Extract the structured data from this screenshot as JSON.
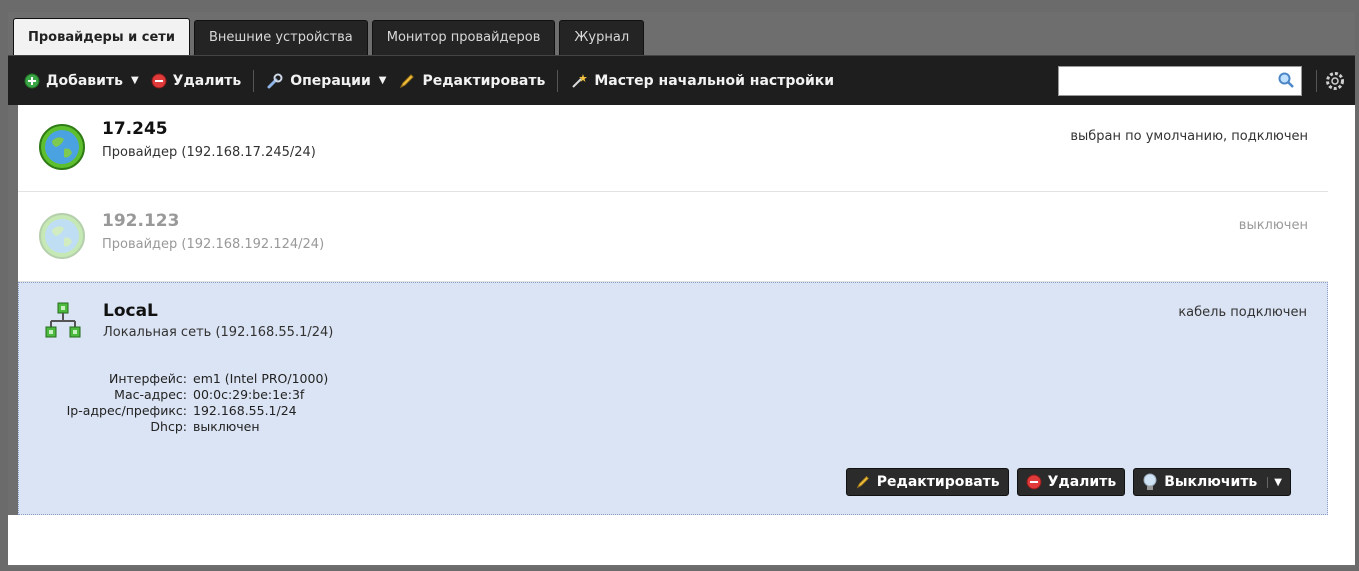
{
  "tabs": [
    {
      "label": "Провайдеры и сети",
      "active": true
    },
    {
      "label": "Внешние устройства",
      "active": false
    },
    {
      "label": "Монитор провайдеров",
      "active": false
    },
    {
      "label": "Журнал",
      "active": false
    }
  ],
  "toolbar": {
    "add_label": "Добавить",
    "delete_label": "Удалить",
    "operations_label": "Операции",
    "edit_label": "Редактировать",
    "wizard_label": "Мастер начальной настройки",
    "search_value": "",
    "search_placeholder": ""
  },
  "items": [
    {
      "name": "17.245",
      "subtitle": "Провайдер (192.168.17.245/24)",
      "state": "выбран по умолчанию, подключен",
      "icon": "globe-icon",
      "enabled": true
    },
    {
      "name": "192.123",
      "subtitle": "Провайдер (192.168.192.124/24)",
      "state": "выключен",
      "icon": "globe-icon",
      "enabled": false
    },
    {
      "name": "LocaL",
      "subtitle": "Локальная сеть (192.168.55.1/24)",
      "state": "кабель подключен",
      "icon": "network-icon",
      "enabled": true,
      "details": [
        {
          "key": "Интерфейс:",
          "value": "em1 (Intel PRO/1000)"
        },
        {
          "key": "Mac-адрес:",
          "value": "00:0c:29:be:1e:3f"
        },
        {
          "key": "Ip-адрес/префикс:",
          "value": "192.168.55.1/24"
        },
        {
          "key": "Dhcp:",
          "value": "выключен"
        }
      ],
      "actions": {
        "edit_label": "Редактировать",
        "delete_label": "Удалить",
        "disable_label": "Выключить"
      }
    }
  ],
  "colors": {
    "toolbar_bg": "#1e1e1e",
    "selected_row": "#dbe4f4",
    "frame_gray": "#6e6e6e"
  }
}
